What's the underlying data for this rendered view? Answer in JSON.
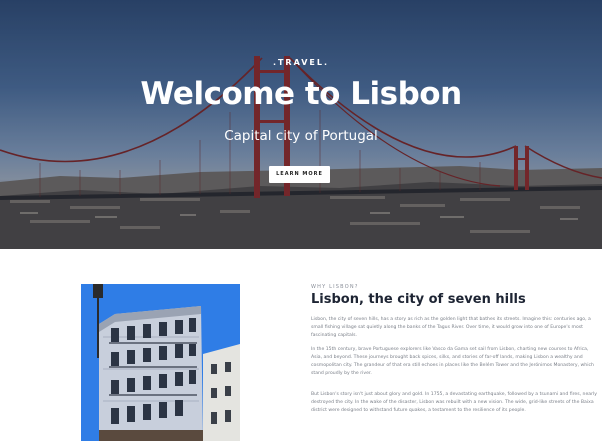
{
  "hero": {
    "brand": ".TRAVEL.",
    "title": "Welcome to Lisbon",
    "subtitle": "Capital city of Portugal",
    "button_label": "LEARN MORE"
  },
  "about": {
    "eyebrow": "WHY LISBON?",
    "title": "Lisbon, the city of seven hills",
    "paragraphs": [
      "Lisbon, the city of seven hills, has a story as rich as the golden light that bathes its streets. Imagine this: centuries ago, a small fishing village sat quietly along the banks of the Tagus River. Over time, it would grow into one of Europe's most fascinating capitals.",
      "In the 15th century, brave Portuguese explorers like Vasco da Gama set sail from Lisbon, charting new courses to Africa, Asia, and beyond. These journeys brought back spices, silks, and stories of far-off lands, making Lisbon a wealthy and cosmopolitan city. The grandeur of that era still echoes in places like the Belém Tower and the Jerónimos Monastery, which stand proudly by the river.",
      "But Lisbon's story isn't just about glory and gold. In 1755, a devastating earthquake, followed by a tsunami and fires, nearly destroyed the city. In the wake of the disaster, Lisbon was rebuilt with a new vision. The wide, grid-like streets of the Baixa district were designed to withstand future quakes, a testament to the resilience of its people."
    ]
  },
  "icons": {
    "hero_background": "bridge-photo",
    "about_photo": "building-photo"
  },
  "colors": {
    "title_dark": "#1d2433",
    "body_gray": "#7a7f88",
    "sky_top": "#2f4a72",
    "bridge_red": "#8a2a2a",
    "photo_sky": "#2f7de6"
  }
}
